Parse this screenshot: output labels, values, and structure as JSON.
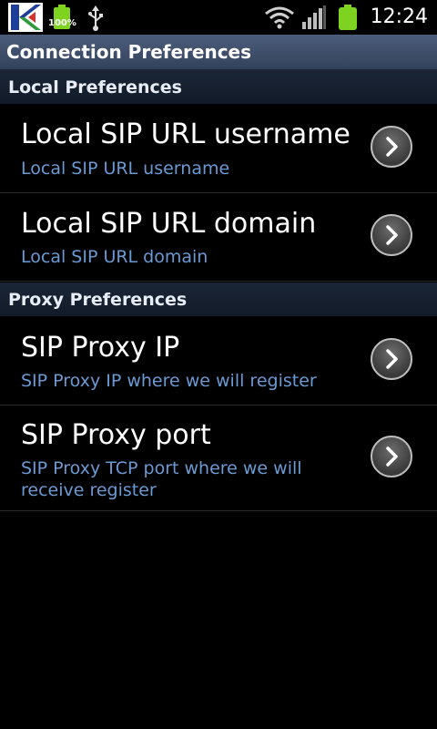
{
  "status_bar": {
    "battery_percent_label": "100%",
    "time": "12:24",
    "icons": [
      "app-k-icon",
      "battery-small-icon",
      "usb-icon",
      "wifi-icon",
      "signal-icon",
      "battery-icon"
    ],
    "battery_color": "#7ed321"
  },
  "title_bar": {
    "title": "Connection Preferences"
  },
  "sections": [
    {
      "header": "Local Preferences",
      "items": [
        {
          "title": "Local SIP URL username",
          "summary": "Local SIP URL username"
        },
        {
          "title": "Local SIP URL domain",
          "summary": "Local SIP URL domain"
        }
      ]
    },
    {
      "header": "Proxy Preferences",
      "items": [
        {
          "title": "SIP Proxy IP",
          "summary": "SIP Proxy IP where we will register"
        },
        {
          "title": "SIP Proxy port",
          "summary": "SIP Proxy TCP port where we will receive register"
        }
      ]
    }
  ],
  "colors": {
    "title_bar": "#3e4d69",
    "section_header": "#16202f",
    "summary_text": "#6b9ad3"
  }
}
